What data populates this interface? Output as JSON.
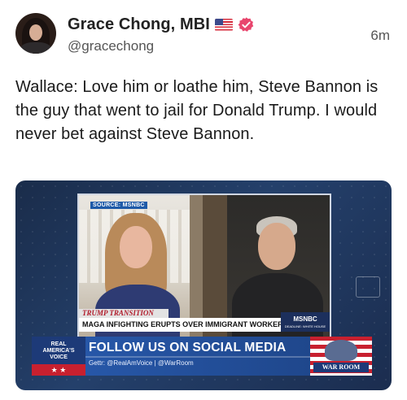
{
  "author": {
    "display_name": "Grace Chong, MBI",
    "handle": "@gracechong",
    "flag_icon": "us-flag-icon",
    "verified_icon": "verified-badge-icon",
    "verified_color": "#e8456d"
  },
  "timestamp": "6m",
  "post_text": "Wallace: Love him or loathe him, Steve Bannon is the guy that went to jail for Donald Trump. I would never bet against Steve Bannon.",
  "media": {
    "source_tag": "SOURCE: MSNBC",
    "chyron_top": "TRUMP TRANSITION",
    "chyron_main": "MAGA INFIGHTING ERUPTS OVER IMMIGRANT WORKER VISAS",
    "network": "MSNBC",
    "network_sub": "DEADLINE: WHITE HOUSE",
    "rav_logo_line1": "REAL",
    "rav_logo_line2": "AMERICA'S",
    "rav_logo_line3": "VOICE",
    "rav_stars": "★          ★",
    "banner_title": "FOLLOW US ON SOCIAL MEDIA",
    "banner_sub": "Gettr: @RealAmVoice | @WarRoom",
    "warroom_label": "WAR ROOM"
  }
}
